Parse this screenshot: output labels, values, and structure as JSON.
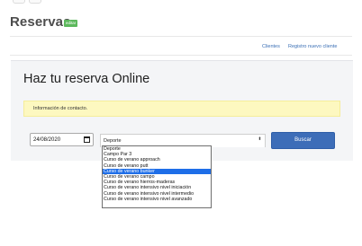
{
  "header": {
    "title": "Reservas",
    "badge": "editar"
  },
  "nav": {
    "links": [
      "Clientes",
      "Registro nuevo cliente"
    ]
  },
  "panel": {
    "title": "Haz tu reserva Online",
    "alert": "Información de contacto."
  },
  "form": {
    "date_value": "24/08/2020",
    "select_value": "Deporte",
    "submit_label": "Buscar",
    "options": [
      "Deporte",
      "Campo Par 3",
      "Curso de verano approach",
      "Curso de verano putt",
      "Curso de verano bunker",
      "Curso de verano campo",
      "Curso de verano hierros-maderas",
      "Curso de verano intensivo nivel iniciación",
      "Curso de verano intensivo nivel intermedio",
      "Curso de verano intensivo nivel avanzado"
    ],
    "highlighted_option": "Curso de verano bunker"
  },
  "colors": {
    "primary_button": "#3d6db8",
    "badge": "#5cb85c",
    "alert_bg": "#fdf8c0",
    "link": "#3a6fb5",
    "selection": "#1e6ee8"
  }
}
